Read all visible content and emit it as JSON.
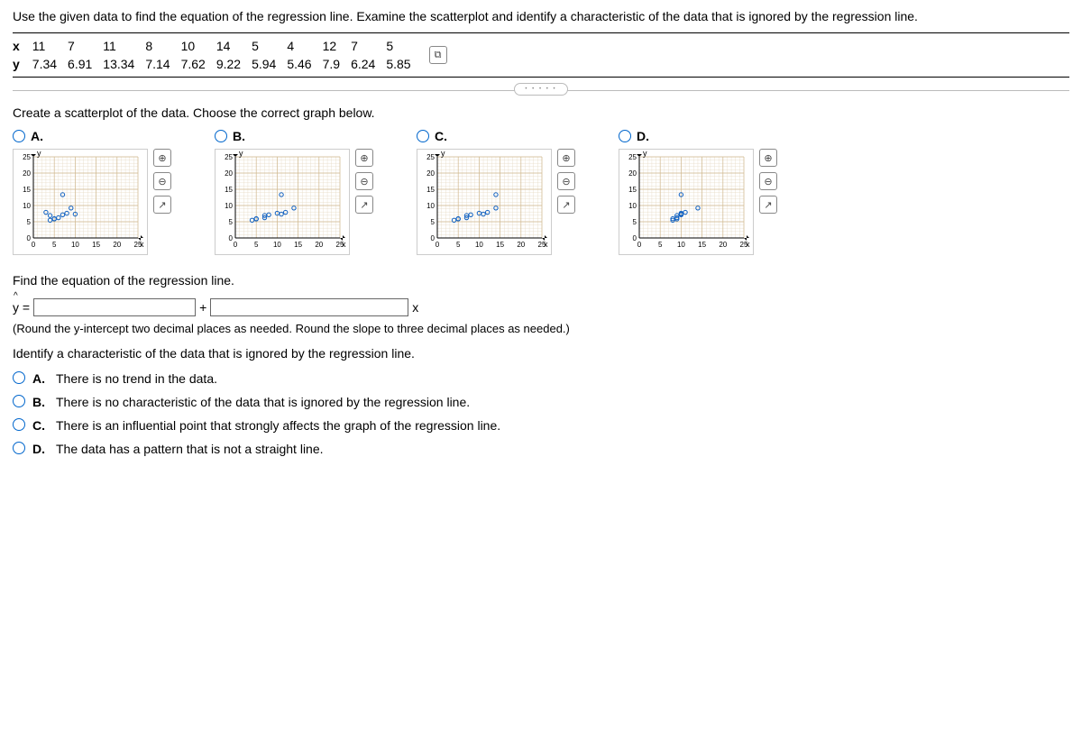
{
  "question": "Use the given data to find the equation of the regression line. Examine the scatterplot and identify a characteristic of the data that is ignored by the regression line.",
  "data_rows": {
    "x_label": "x",
    "y_label": "y",
    "x": [
      "11",
      "7",
      "11",
      "8",
      "10",
      "14",
      "5",
      "4",
      "12",
      "7",
      "5"
    ],
    "y": [
      "7.34",
      "6.91",
      "13.34",
      "7.14",
      "7.62",
      "9.22",
      "5.94",
      "5.46",
      "7.9",
      "6.24",
      "5.85"
    ]
  },
  "sub_instruction": "Create a scatterplot of the data. Choose the correct graph below.",
  "options": {
    "a": "A.",
    "b": "B.",
    "c": "C.",
    "d": "D."
  },
  "axis": {
    "x_ticks": [
      "0",
      "5",
      "10",
      "15",
      "20",
      "25"
    ],
    "y_ticks": [
      "0",
      "5",
      "10",
      "15",
      "20",
      "25"
    ],
    "x_label": "x",
    "y_label": "y"
  },
  "chart_data": [
    {
      "id": "A",
      "type": "scatter",
      "xlim": [
        0,
        25
      ],
      "ylim": [
        0,
        25
      ],
      "points": [
        [
          4,
          5.46
        ],
        [
          4,
          6.91
        ],
        [
          5,
          5.94
        ],
        [
          5,
          5.85
        ],
        [
          6,
          6.24
        ],
        [
          7,
          13.34
        ],
        [
          7,
          7.14
        ],
        [
          8,
          7.62
        ],
        [
          9,
          9.22
        ],
        [
          10,
          7.34
        ],
        [
          3,
          7.9
        ]
      ]
    },
    {
      "id": "B",
      "type": "scatter",
      "xlim": [
        0,
        25
      ],
      "ylim": [
        0,
        25
      ],
      "points": [
        [
          4,
          5.46
        ],
        [
          5,
          5.94
        ],
        [
          5,
          5.85
        ],
        [
          7,
          6.91
        ],
        [
          7,
          6.24
        ],
        [
          8,
          7.14
        ],
        [
          10,
          7.62
        ],
        [
          11,
          7.34
        ],
        [
          11,
          13.34
        ],
        [
          12,
          7.9
        ],
        [
          14,
          9.22
        ]
      ]
    },
    {
      "id": "C",
      "type": "scatter",
      "xlim": [
        0,
        25
      ],
      "ylim": [
        0,
        25
      ],
      "points": [
        [
          4,
          5.46
        ],
        [
          5,
          5.94
        ],
        [
          5,
          5.85
        ],
        [
          7,
          6.91
        ],
        [
          7,
          6.24
        ],
        [
          8,
          7.14
        ],
        [
          10,
          7.62
        ],
        [
          11,
          7.34
        ],
        [
          14,
          13.34
        ],
        [
          12,
          7.9
        ],
        [
          14,
          9.22
        ]
      ]
    },
    {
      "id": "D",
      "type": "scatter",
      "xlim": [
        0,
        25
      ],
      "ylim": [
        0,
        25
      ],
      "points": [
        [
          8,
          5.46
        ],
        [
          8,
          5.94
        ],
        [
          9,
          5.85
        ],
        [
          9,
          6.91
        ],
        [
          9,
          6.24
        ],
        [
          10,
          7.14
        ],
        [
          10,
          7.62
        ],
        [
          10,
          7.34
        ],
        [
          10,
          13.34
        ],
        [
          11,
          7.9
        ],
        [
          14,
          9.22
        ]
      ]
    }
  ],
  "find_eq_heading": "Find the equation of the regression line.",
  "equation": {
    "y_eq": "y =",
    "plus": "+",
    "x": "x"
  },
  "round_hint": "(Round the y-intercept two decimal places as needed. Round the slope to three decimal places as needed.)",
  "identify_heading": "Identify a characteristic of the data that is ignored by the regression line.",
  "mc": {
    "a": {
      "label": "A.",
      "text": "There is no trend in the data."
    },
    "b": {
      "label": "B.",
      "text": "There is no characteristic of the data that is ignored by the regression line."
    },
    "c": {
      "label": "C.",
      "text": "There is an influential point that strongly affects the graph of the regression line."
    },
    "d": {
      "label": "D.",
      "text": "The data has a pattern that is not a straight line."
    }
  },
  "icons": {
    "zoom_in": "⊕",
    "zoom_out": "⊖",
    "popout": "↗",
    "copy": "⧉"
  }
}
